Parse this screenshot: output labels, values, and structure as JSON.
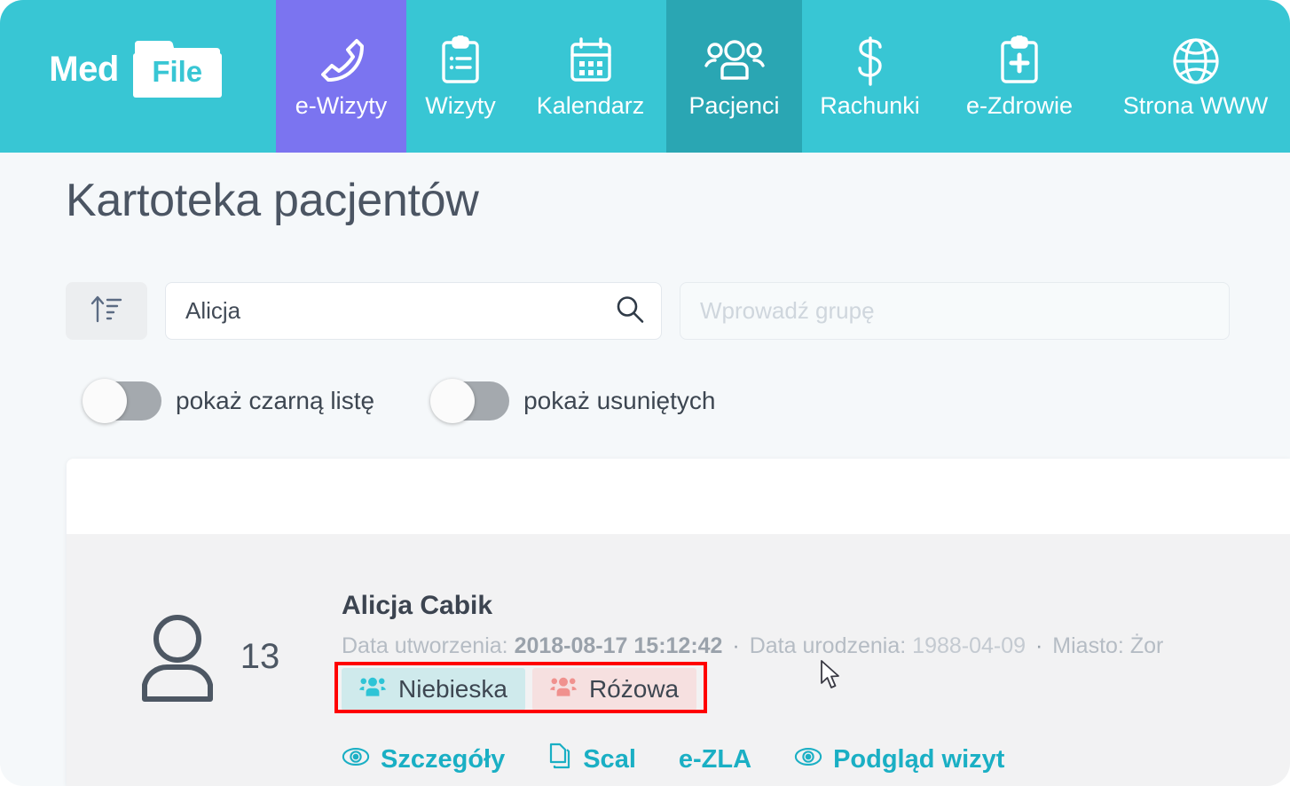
{
  "brand": {
    "text_primary": "Med",
    "text_badge": "File"
  },
  "nav": {
    "items": [
      {
        "label": "e-Wizyty",
        "icon": "phone-call-icon",
        "state": "highlight",
        "color": "#7b74f0"
      },
      {
        "label": "Wizyty",
        "icon": "clipboard-list-icon",
        "state": "default",
        "color": "#38c6d4"
      },
      {
        "label": "Kalendarz",
        "icon": "calendar-icon",
        "state": "default",
        "color": "#38c6d4"
      },
      {
        "label": "Pacjenci",
        "icon": "users-group-icon",
        "state": "active",
        "color": "#2aa6b3"
      },
      {
        "label": "Rachunki",
        "icon": "dollar-icon",
        "state": "default",
        "color": "#38c6d4"
      },
      {
        "label": "e-Zdrowie",
        "icon": "clipboard-cross-icon",
        "state": "default",
        "color": "#38c6d4"
      },
      {
        "label": "Strona WWW",
        "icon": "globe-icon",
        "state": "default",
        "color": "#38c6d4"
      }
    ]
  },
  "page": {
    "title": "Kartoteka pacjentów"
  },
  "filters": {
    "sort_icon": "sort-ascending-icon",
    "search": {
      "value": "Alicja",
      "placeholder": "",
      "icon": "search-icon"
    },
    "group": {
      "value": "",
      "placeholder": "Wprowadź grupę"
    },
    "toggles": [
      {
        "label": "pokaż czarną listę",
        "on": false
      },
      {
        "label": "pokaż usuniętych",
        "on": false
      }
    ]
  },
  "results": {
    "patient": {
      "avatar_icon": "user-avatar-icon",
      "count": "13",
      "name": "Alicja Cabik",
      "meta": {
        "created_label": "Data utworzenia:",
        "created_value": "2018-08-17 15:12:42",
        "separator": "·",
        "birth_label": "Data urodzenia:",
        "birth_value": "1988-04-09",
        "city_label": "Miasto:",
        "city_value": "Żor"
      },
      "tags": [
        {
          "label": "Niebieska",
          "icon": "users-group-icon",
          "bg": "#cfeaec",
          "icon_color": "#2ec4d6"
        },
        {
          "label": "Różowa",
          "icon": "users-group-icon",
          "bg": "#f6e0e0",
          "icon_color": "#f0918e"
        }
      ],
      "actions": [
        {
          "label": "Szczegóły",
          "icon": "eye-icon"
        },
        {
          "label": "Scal",
          "icon": "copy-documents-icon"
        },
        {
          "label": "e-ZLA",
          "icon": "none"
        },
        {
          "label": "Podgląd wizyt",
          "icon": "eye-icon"
        }
      ]
    }
  },
  "annotation": {
    "highlight_color": "#ff0000",
    "target": "patient-group-tags"
  }
}
